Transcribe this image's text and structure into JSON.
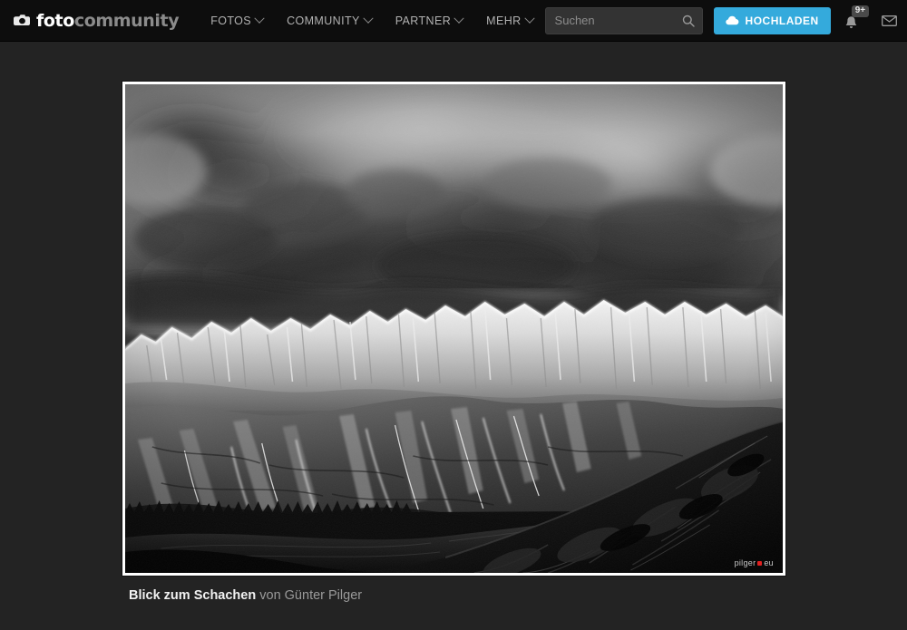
{
  "header": {
    "logo": {
      "part1": "foto",
      "part2": "community",
      "icon": "camera-icon"
    },
    "nav": [
      {
        "label": "FOTOS"
      },
      {
        "label": "COMMUNITY"
      },
      {
        "label": "PARTNER"
      },
      {
        "label": "MEHR"
      }
    ],
    "search": {
      "placeholder": "Suchen",
      "value": "",
      "icon": "search-icon"
    },
    "upload_button": {
      "label": "HOCHLADEN",
      "icon": "cloud-upload-icon",
      "color": "#34aadc"
    },
    "notifications": {
      "badge": "9+",
      "icon": "bell-icon"
    },
    "messages": {
      "icon": "envelope-icon"
    },
    "avatar": {
      "alt": "user-avatar"
    }
  },
  "photo": {
    "title": "Blick zum Schachen",
    "byline": "von Günter Pilger",
    "watermark": {
      "prefix": "pilger",
      "suffix": "eu",
      "dot_color": "#e02020"
    },
    "description": "Black and white photograph of a mountain range with dark storm clouds above snow covered peaks and a shadowed ridge in the foreground"
  },
  "colors": {
    "page_background": "#232323",
    "header_background": "#0d0d0d",
    "accent": "#34aadc",
    "frame": "#ffffff"
  }
}
